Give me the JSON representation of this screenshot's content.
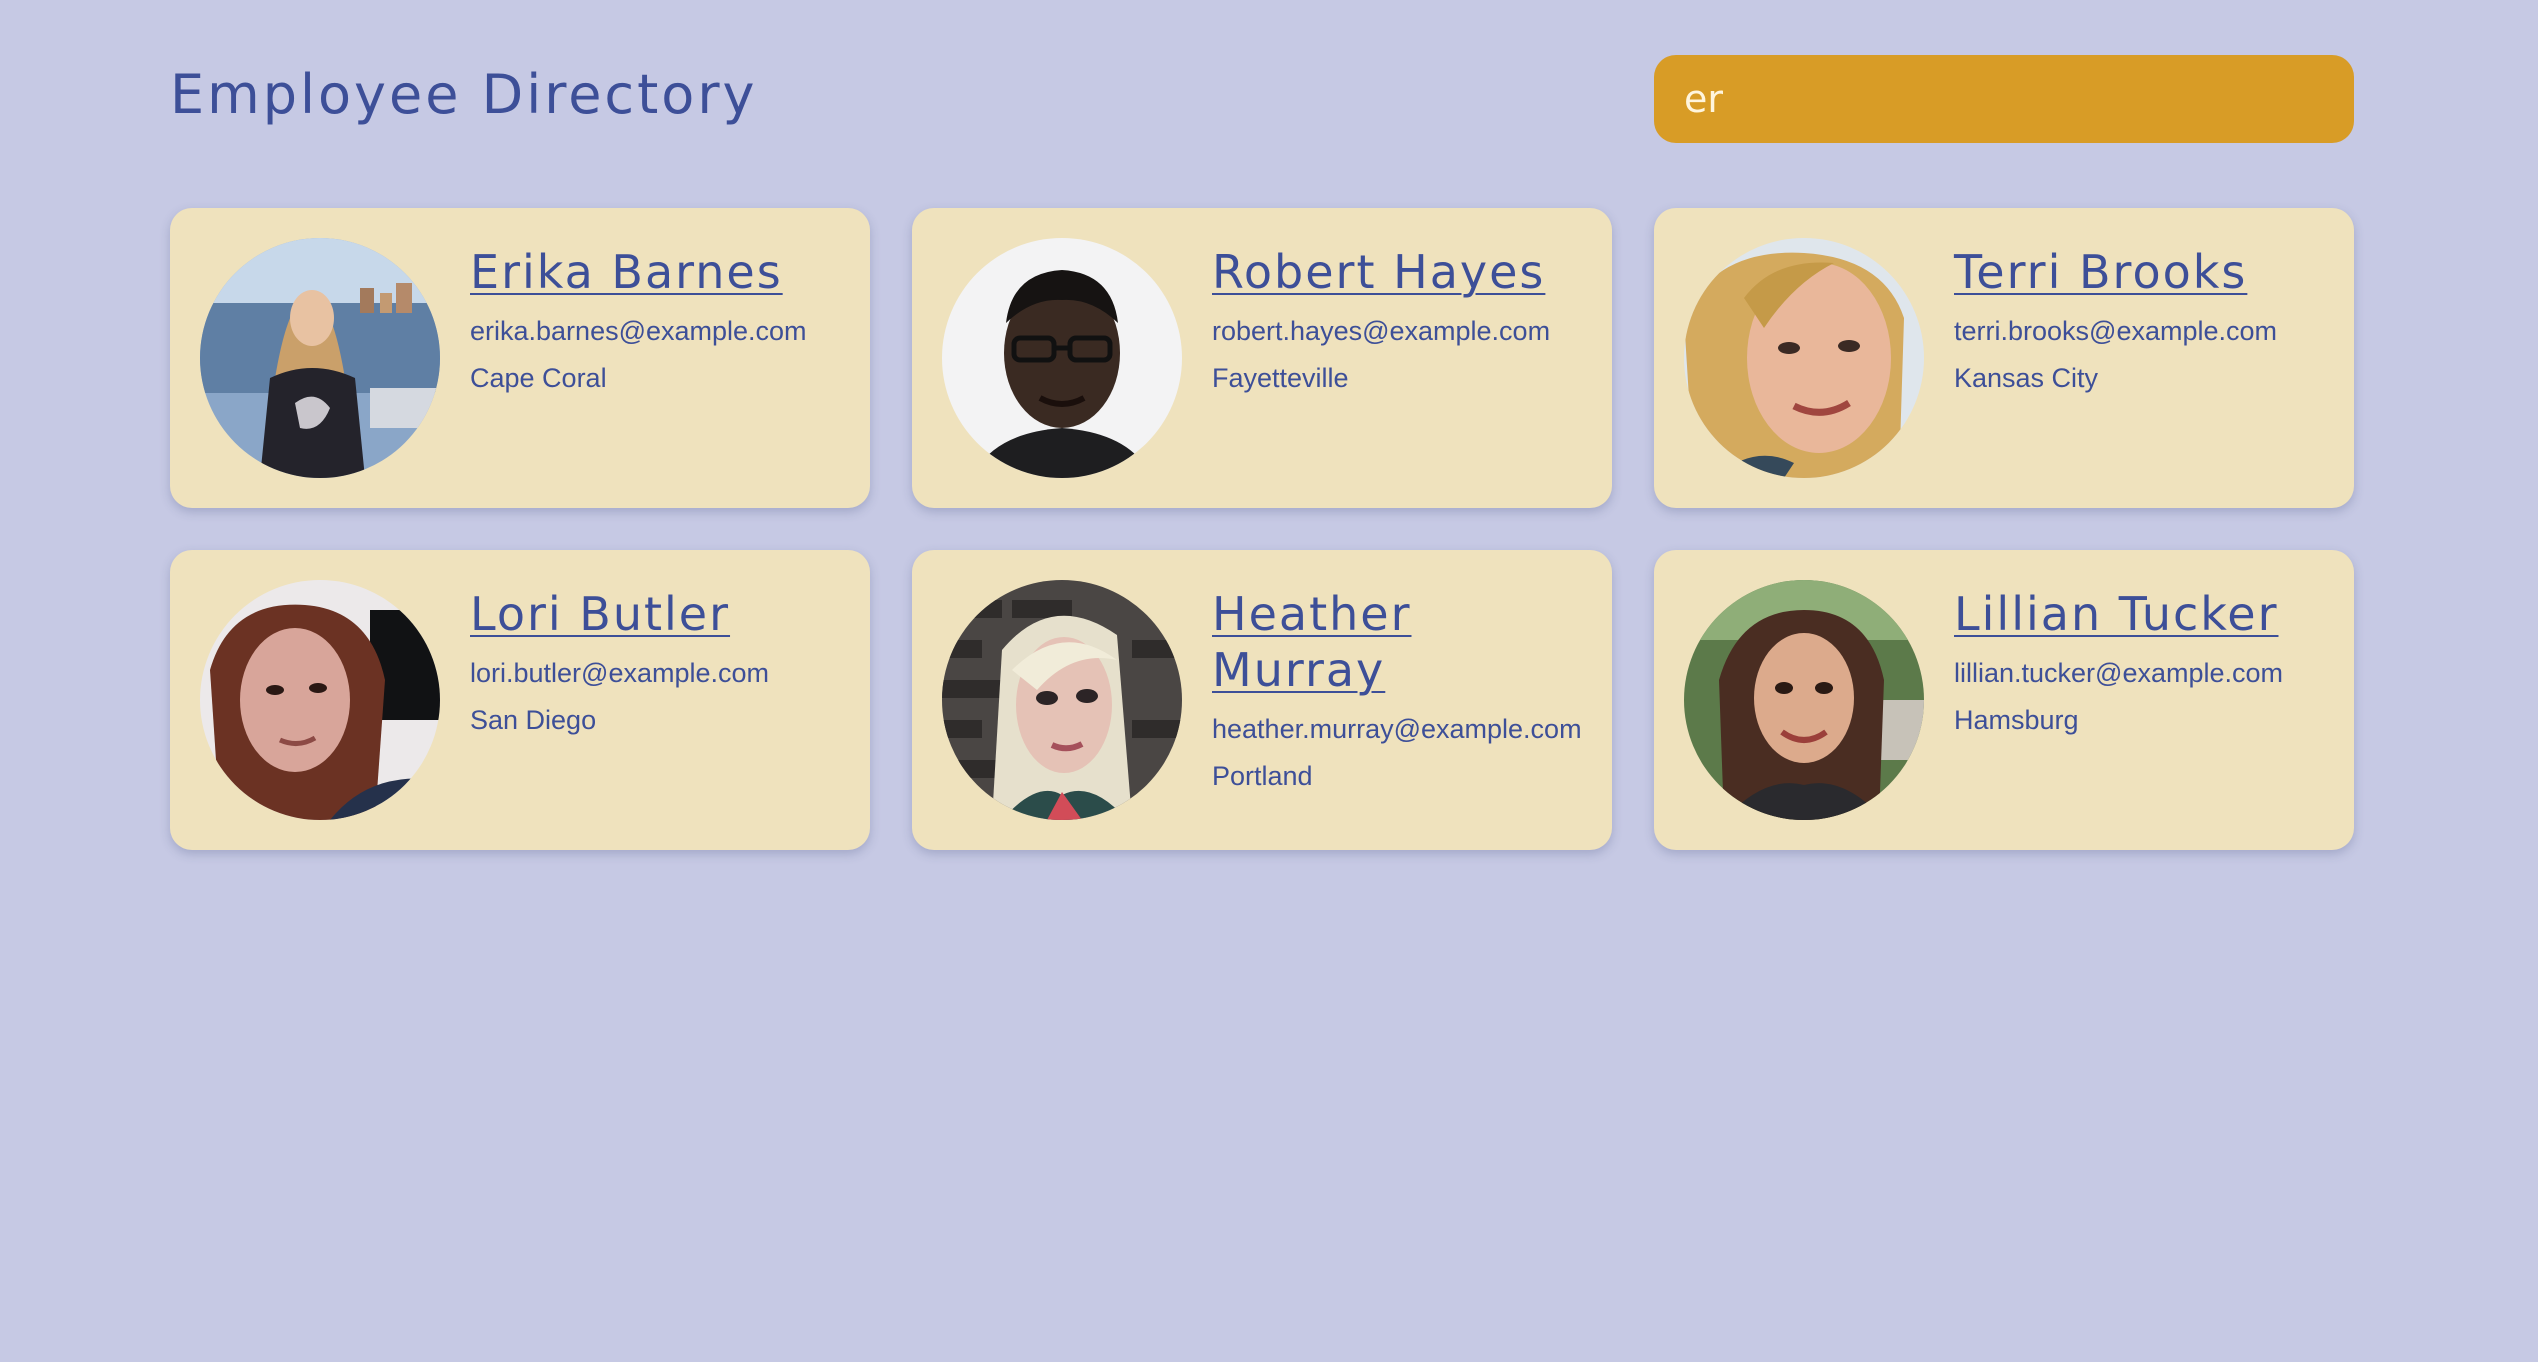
{
  "header": {
    "title": "Employee Directory"
  },
  "search": {
    "value": "er"
  },
  "employees": [
    {
      "name": "Erika Barnes",
      "email": "erika.barnes@example.com",
      "city": "Cape Coral"
    },
    {
      "name": "Robert Hayes",
      "email": "robert.hayes@example.com",
      "city": "Fayetteville"
    },
    {
      "name": "Terri Brooks",
      "email": "terri.brooks@example.com",
      "city": "Kansas City"
    },
    {
      "name": "Lori Butler",
      "email": "lori.butler@example.com",
      "city": "San Diego"
    },
    {
      "name": "Heather Murray",
      "email": "heather.murray@example.com",
      "city": "Portland"
    },
    {
      "name": "Lillian Tucker",
      "email": "lillian.tucker@example.com",
      "city": "Hamsburg"
    }
  ],
  "colors": {
    "background": "#c6c9e4",
    "card": "#efe2bd",
    "accent": "#d89c26",
    "text": "#3d4f98"
  }
}
